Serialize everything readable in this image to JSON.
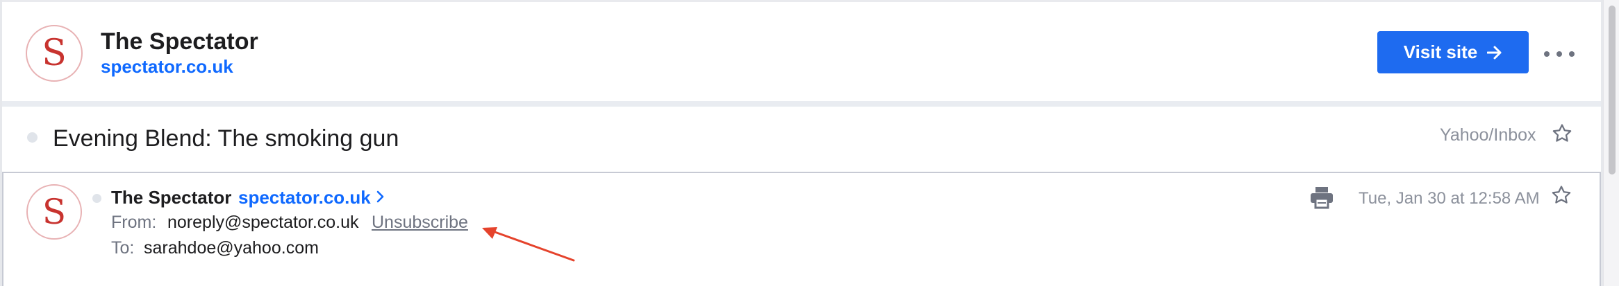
{
  "sender_header": {
    "logo_letter": "S",
    "name": "The Spectator",
    "domain": "spectator.co.uk",
    "visit_button_label": "Visit site",
    "more_icon": "more-horizontal-icon"
  },
  "subject_row": {
    "subject": "Evening Blend: The smoking gun",
    "folder_path": "Yahoo/Inbox",
    "star_icon": "star-outline-icon"
  },
  "message": {
    "logo_letter": "S",
    "sender_name": "The Spectator",
    "sender_domain": "spectator.co.uk",
    "from_label": "From:",
    "from_value": "noreply@spectator.co.uk",
    "unsubscribe_label": "Unsubscribe",
    "to_label": "To:",
    "to_value": "sarahdoe@yahoo.com",
    "date": "Tue, Jan 30 at 12:58 AM",
    "print_icon": "print-icon",
    "star_icon": "star-outline-icon"
  },
  "colors": {
    "accent_blue": "#1e6bf0",
    "link_blue": "#0f69ff",
    "logo_red": "#c8332f",
    "annotation_red": "#e5432c",
    "muted_text": "#8c919c"
  }
}
